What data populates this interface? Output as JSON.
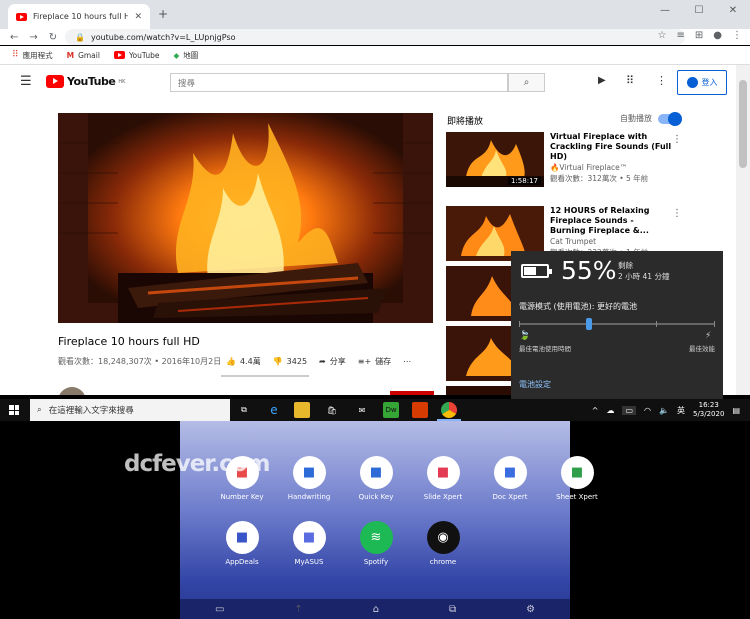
{
  "browser": {
    "tab_title": "Fireplace 10 hours full HD",
    "url": "youtube.com/watch?v=L_LUpnjgPso",
    "bookmarks": [
      "應用程式",
      "Gmail",
      "YouTube",
      "地圖"
    ]
  },
  "youtube": {
    "logo": "YouTube",
    "logo_region": "HK",
    "search_placeholder": "搜尋",
    "signin": "登入",
    "video": {
      "title": "Fireplace 10 hours full HD",
      "meta": "觀看次數：18,248,307次 • 2016年10月2日",
      "likes": "4.4萬",
      "dislikes": "3425",
      "share": "分享",
      "save": "儲存"
    },
    "up_next": "即將播放",
    "autoplay": "自動播放",
    "recs": [
      {
        "title": "Virtual Fireplace with Crackling Fire Sounds (Full HD)",
        "channel": "🔥Virtual Fireplace™",
        "meta": "觀看次數：312萬次 • 5 年前",
        "duration": "1:58:17"
      },
      {
        "title": "12 HOURS of Relaxing Fireplace Sounds - Burning Fireplace &...",
        "channel": "Cat Trumpet",
        "meta": "觀看次數：232萬次 • 1 年前",
        "duration": ""
      }
    ]
  },
  "battery": {
    "percent_text": "55%",
    "level": 0.55,
    "remaining_label": "剩餘",
    "remaining": "2 小時 41 分鐘",
    "mode": "電源模式 (使用電池): 更好的電池",
    "left_label": "最佳電池使用時間",
    "right_label": "最佳效能",
    "settings": "電池設定"
  },
  "taskbar": {
    "search_placeholder": "在這裡輸入文字來搜尋",
    "ime": "英",
    "time": "16:23",
    "date": "5/3/2020"
  },
  "screenxpert": {
    "watermark": "dcfever.com",
    "apps_row1": [
      {
        "label": "Number Key",
        "icon": "number-key-icon",
        "color": "#e84a4a"
      },
      {
        "label": "Handwriting",
        "icon": "handwriting-icon",
        "color": "#2d6bd6"
      },
      {
        "label": "Quick Key",
        "icon": "quick-key-icon",
        "color": "#2d6bd6"
      },
      {
        "label": "Slide Xpert",
        "icon": "slide-xpert-icon",
        "color": "#e23b53"
      },
      {
        "label": "Doc Xpert",
        "icon": "doc-xpert-icon",
        "color": "#3a6ee0"
      },
      {
        "label": "Sheet Xpert",
        "icon": "sheet-xpert-icon",
        "color": "#2e9e4a"
      }
    ],
    "apps_row2": [
      {
        "label": "AppDeals",
        "icon": "appdeals-icon",
        "color": "#3a55c8"
      },
      {
        "label": "MyASUS",
        "icon": "myasus-icon",
        "color": "#5a6de0"
      },
      {
        "label": "Spotify",
        "icon": "spotify-icon",
        "color": "#1db954"
      },
      {
        "label": "chrome",
        "icon": "chrome-icon",
        "color": "#111"
      }
    ]
  }
}
